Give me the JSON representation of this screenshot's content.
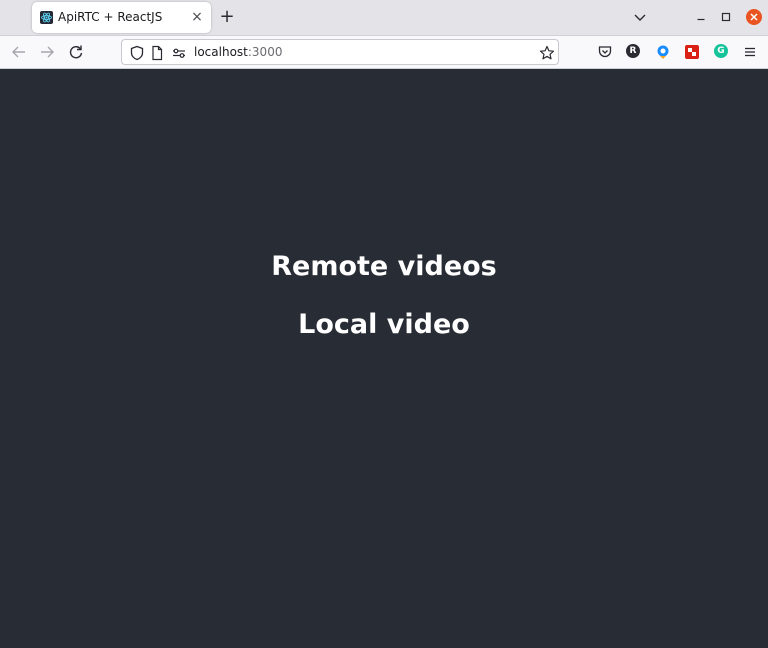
{
  "tab": {
    "title": "ApiRTC + ReactJS",
    "close_glyph": "×",
    "favicon": "react-logo-icon"
  },
  "new_tab_glyph": "+",
  "url": {
    "host": "localhost",
    "port": ":3000"
  },
  "extensions": [
    {
      "name": "pocket-icon"
    },
    {
      "name": "profile-r-icon",
      "label": "R",
      "color": "#2b2a33"
    },
    {
      "name": "extension-location-icon",
      "color": "#1a8cff"
    },
    {
      "name": "extension-red-icon",
      "color": "#d92215"
    },
    {
      "name": "grammarly-icon",
      "label": "G",
      "color": "#15c39a"
    }
  ],
  "page": {
    "heading_remote": "Remote videos",
    "heading_local": "Local video",
    "background": "#282c34"
  },
  "colors": {
    "window_close": "#e95420",
    "tab_strip": "#e4e3e7"
  }
}
